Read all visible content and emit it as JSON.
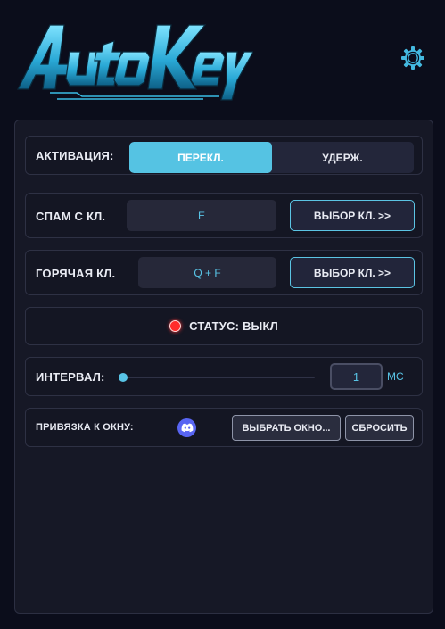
{
  "app": {
    "logo_text": "AutoKey"
  },
  "activation": {
    "label": "АКТИВАЦИЯ:",
    "options": [
      "ПЕРЕКЛ.",
      "УДЕРЖ."
    ],
    "selected": "ПЕРЕКЛ."
  },
  "spam": {
    "label": "СПАМ С КЛ.",
    "key": "E",
    "button": "ВЫБОР КЛ. >>"
  },
  "hotkey": {
    "label": "ГОРЯЧАЯ КЛ.",
    "key": "Q + F",
    "button": "ВЫБОР КЛ. >>"
  },
  "status": {
    "text": "СТАТУС: ВЫКЛ",
    "color": "#ff2b2b"
  },
  "interval": {
    "label": "ИНТЕРВАЛ:",
    "value": "1",
    "unit": "МС",
    "slider_level": 0
  },
  "window_bind": {
    "label": "ПРИВЯЗКА К ОКНУ:",
    "icon": "discord-icon",
    "select_button": "ВЫБРАТЬ ОКНО...",
    "reset_button": "СБРОСИТЬ"
  },
  "colors": {
    "accent": "#55c3e3",
    "background": "#0b0d1b",
    "panel": "#161826"
  }
}
